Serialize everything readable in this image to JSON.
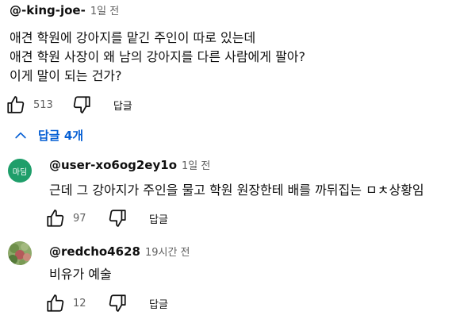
{
  "main_comment": {
    "author": "@-king-joe-",
    "time": "1일 전",
    "lines": [
      "애견 학원에 강아지를 맡긴 주인이 따로 있는데",
      "애견 학원 사장이 왜 남의 강아지를 다른 사람에게 팔아?",
      "이게 말이 되는 건가?"
    ],
    "likes": "513",
    "reply_label": "답글"
  },
  "replies_toggle": {
    "label": "답글 4개",
    "color": "#065fd4"
  },
  "replies": [
    {
      "author": "@user-xo6og2ey1o",
      "time": "1일 전",
      "avatar_text": "마딤",
      "avatar_color": "#1e9e6a",
      "text": "근데 그 강아지가 주인을 물고 학원 원장한테 배를 까뒤집는 ㅁㅊ상황임",
      "likes": "97",
      "reply_label": "답글"
    },
    {
      "author": "@redcho4628",
      "time": "19시간 전",
      "text": "비유가 예술",
      "likes": "12",
      "reply_label": "답글"
    }
  ]
}
